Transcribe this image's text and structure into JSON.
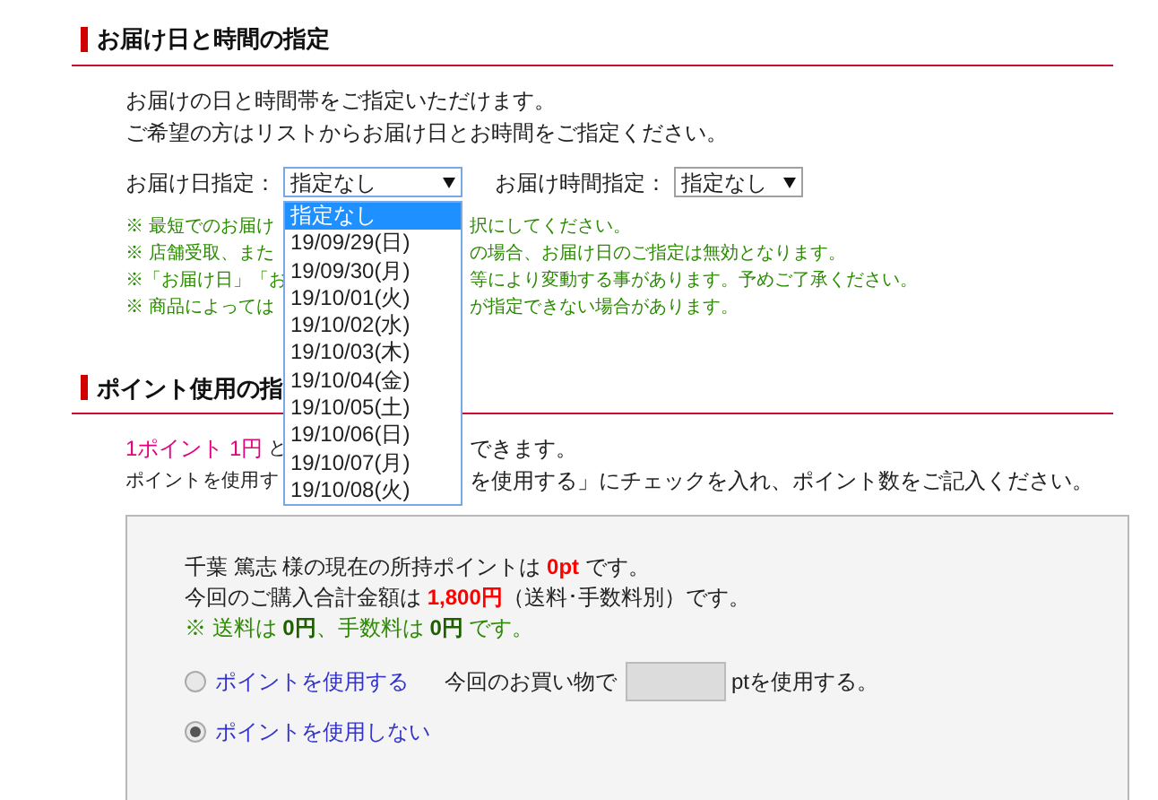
{
  "delivery": {
    "heading": "お届け日と時間の指定",
    "intro": [
      "お届けの日と時間帯をご指定いただけます。",
      "ご希望の方はリストからお届け日とお時間をご指定ください。"
    ],
    "date_select": {
      "label": "お届け日指定：",
      "value": "指定なし",
      "open": true,
      "options": [
        {
          "label": "指定なし",
          "selected": true
        },
        {
          "label": "19/09/29(日)",
          "selected": false
        },
        {
          "label": "19/09/30(月)",
          "selected": false
        },
        {
          "label": "19/10/01(火)",
          "selected": false
        },
        {
          "label": "19/10/02(水)",
          "selected": false
        },
        {
          "label": "19/10/03(木)",
          "selected": false
        },
        {
          "label": "19/10/04(金)",
          "selected": false
        },
        {
          "label": "19/10/05(土)",
          "selected": false
        },
        {
          "label": "19/10/06(日)",
          "selected": false
        },
        {
          "label": "19/10/07(月)",
          "selected": false
        },
        {
          "label": "19/10/08(火)",
          "selected": false
        }
      ]
    },
    "time_select": {
      "label": "お届け時間指定：",
      "value": "指定なし"
    },
    "notes": [
      {
        "start": "※ 最短でのお届け",
        "end": "択にしてください。"
      },
      {
        "start": "※ 店舗受取、また",
        "end": "の場合、お届け日のご指定は無効となります。"
      },
      {
        "start": "※「お届け日」「お",
        "end": "等により変動する事があります。予めご了承ください。"
      },
      {
        "start": "※ 商品によっては",
        "end": "が指定できない場合があります。"
      }
    ]
  },
  "points": {
    "heading": "ポイント使用の指",
    "intro": [
      {
        "highlight": "1ポイント 1円",
        "start": " と",
        "end": "できます。"
      },
      {
        "start": "ポイントを使用す",
        "end": "を使用する」にチェックを入れ、ポイント数をご記入ください。"
      }
    ],
    "box": {
      "lines": [
        {
          "kind": "plain",
          "segments": [
            {
              "text": "千葉 篤志 様の現在の所持ポイントは ",
              "emphasis": false
            },
            {
              "text": "0pt",
              "emphasis": true
            },
            {
              "text": " です。",
              "emphasis": false
            }
          ]
        },
        {
          "kind": "plain",
          "segments": [
            {
              "text": "今回のご購入合計金額は ",
              "emphasis": false
            },
            {
              "text": "1,800円",
              "emphasis": true
            },
            {
              "text": "（送料･手数料別）です。",
              "emphasis": false
            }
          ]
        },
        {
          "kind": "note",
          "segments": [
            {
              "text": "※ 送料は ",
              "emphasis": false
            },
            {
              "text": "0円",
              "emphasis": true
            },
            {
              "text": "、手数料は ",
              "emphasis": false
            },
            {
              "text": "0円",
              "emphasis": true
            },
            {
              "text": " です。",
              "emphasis": false
            }
          ]
        }
      ],
      "options": [
        {
          "label": "ポイントを使用する",
          "selected": false,
          "amount": {
            "prefix": "今回のお買い物で",
            "suffix": "ptを使用する。",
            "disabled": true
          }
        },
        {
          "label": "ポイントを使用しない",
          "selected": true
        }
      ]
    }
  }
}
